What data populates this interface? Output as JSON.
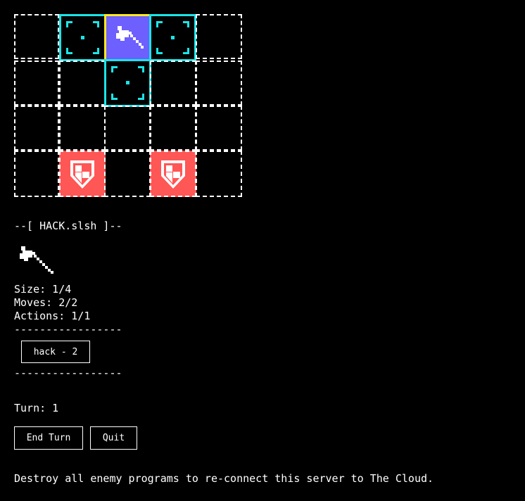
{
  "board": {
    "rows": 4,
    "cols": 5,
    "cells": [
      {
        "row": 0,
        "col": 1,
        "type": "move-target"
      },
      {
        "row": 0,
        "col": 2,
        "type": "selected-program",
        "icon": "axe-icon"
      },
      {
        "row": 0,
        "col": 3,
        "type": "move-target"
      },
      {
        "row": 1,
        "col": 2,
        "type": "move-target"
      },
      {
        "row": 3,
        "col": 1,
        "type": "enemy-program",
        "icon": "shield-icon"
      },
      {
        "row": 3,
        "col": 3,
        "type": "enemy-program",
        "icon": "shield-icon"
      }
    ],
    "colors": {
      "move_target": "#19e5e8",
      "selected_border": "#ffe820",
      "selected_fill": "#6e5fff",
      "enemy_fill": "#ff5656"
    }
  },
  "program": {
    "header": "--[ HACK.slsh ]--",
    "icon": "axe-icon",
    "size_text": "Size: 1/4",
    "moves_text": "Moves: 2/2",
    "actions_text": "Actions: 1/1",
    "separator": "-----------------",
    "action_button": "hack - 2"
  },
  "turn_text": "Turn: 1",
  "buttons": {
    "end_turn": "End Turn",
    "quit": "Quit"
  },
  "message": "Destroy all enemy programs to re-connect this server to The Cloud."
}
